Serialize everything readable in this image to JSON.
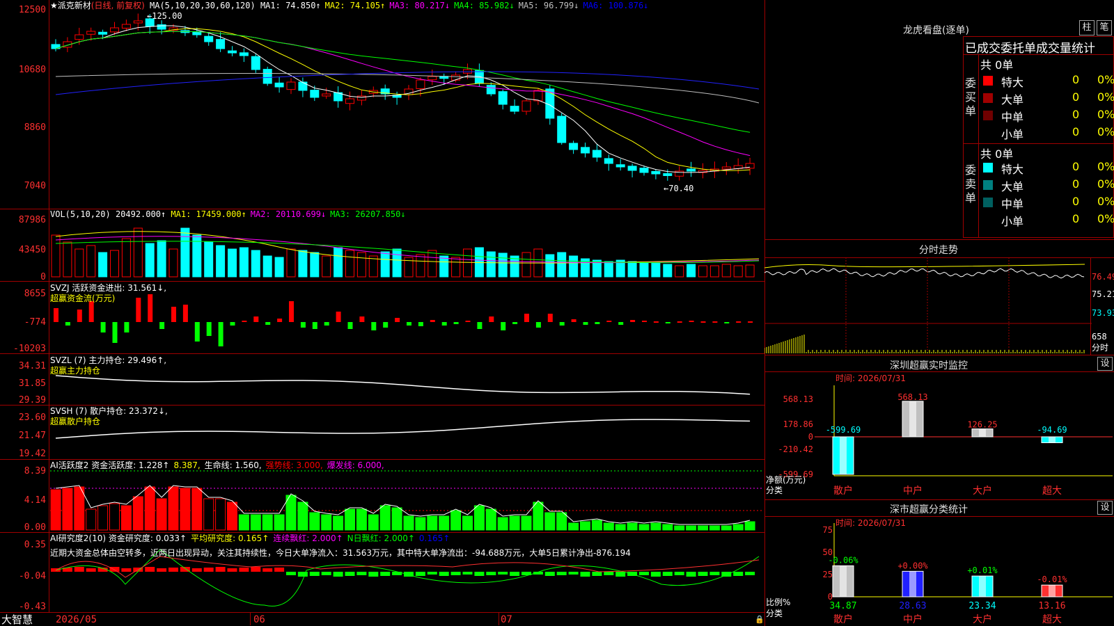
{
  "stock": {
    "name": "★派克新材",
    "mode": "(日线, 前复权)",
    "ma_header": "MA(5,10,20,30,60,120)",
    "ma_values": [
      {
        "label": "MA1: 74.850↑",
        "color": "#ffffff"
      },
      {
        "label": "MA2: 74.105↑",
        "color": "#ffff00"
      },
      {
        "label": "MA3: 80.217↓",
        "color": "#ff00ff"
      },
      {
        "label": "MA4: 85.982↓",
        "color": "#00ff00"
      },
      {
        "label": "MA5: 96.799↓",
        "color": "#c0c0c0"
      },
      {
        "label": "MA6: 100.876↓",
        "color": "#0000ff"
      }
    ]
  },
  "colors": {
    "up": "#ff0000",
    "down": "#00ffff",
    "grid": "#a00000",
    "ma1": "#ffffff",
    "ma2": "#ffff00",
    "ma3": "#ff00ff",
    "ma4": "#00ff00",
    "ma5": "#c0c0c0",
    "ma6": "#2222ff",
    "label_gold": "#ffff00"
  },
  "main_chart": {
    "y_labels": [
      "12500",
      "10680",
      "8860",
      "7040"
    ],
    "high_mark": "←125.00",
    "low_mark": "←70.40"
  },
  "vol_panel": {
    "header_name": "VOL(5,10,20)",
    "header_value": "20492.000↑",
    "ma": [
      {
        "label": "MA1: 17459.000↑",
        "color": "#ffff00"
      },
      {
        "label": "MA2: 20110.699↓",
        "color": "#ff00ff"
      },
      {
        "label": "MA3: 26207.850↓",
        "color": "#00ff00"
      }
    ],
    "y_labels": [
      "87986",
      "43450",
      "0"
    ]
  },
  "svzj_panel": {
    "header": "SVZJ  活跃资金进出: 31.561↓,",
    "sub": "超赢资金流(万元)",
    "y_labels": [
      "8655",
      "-774",
      "-10203"
    ]
  },
  "svzl_panel": {
    "header": "SVZL (7) 主力持仓: 29.496↑,",
    "sub": "超赢主力持仓",
    "y_labels": [
      "34.31",
      "31.85",
      "29.39"
    ]
  },
  "svsh_panel": {
    "header": "SVSH (7) 散户持仓: 23.372↓,",
    "sub": "超赢散户持仓",
    "y_labels": [
      "23.60",
      "21.47",
      "19.42"
    ]
  },
  "ai_active_panel": {
    "header_parts": [
      {
        "text": "AI活跃度2 资金活跃度: 1.228↑",
        "color": "#ffffff"
      },
      {
        "text": "8.387,",
        "color": "#ffff00"
      },
      {
        "text": "生命线: 1.560,",
        "color": "#ffffff"
      },
      {
        "text": "强势线: 3.000,",
        "color": "#ff0000"
      },
      {
        "text": "爆发线: 6.000,",
        "color": "#ff00ff"
      }
    ],
    "y_labels": [
      "8.39",
      "4.14",
      "0.00"
    ]
  },
  "ai_research_panel": {
    "header_parts": [
      {
        "text": "AI研究度2(10) 资金研究度: 0.033↑",
        "color": "#ffffff"
      },
      {
        "text": "平均研究度: 0.165↑",
        "color": "#ffff00"
      },
      {
        "text": "连续飘红: 2.000↑",
        "color": "#ff00ff"
      },
      {
        "text": "N日飘红: 2.000↑",
        "color": "#00ff00"
      },
      {
        "text": "0.165↑",
        "color": "#0000ff"
      }
    ],
    "comment": "近期大资金总体由空转多，近两日出现异动，关注其持续性，今日大单净流入：31.563万元，其中特大单净流出：-94.688万元，大单5日累计净出-876.194",
    "y_labels": [
      "0.35",
      "-0.04",
      "-0.43"
    ]
  },
  "x_axis": {
    "labels": [
      "2026/05",
      "06",
      "07"
    ]
  },
  "bottom": {
    "brand": "大智慧"
  },
  "right_panel": {
    "dragon_title": "龙虎看盘(逐单)",
    "btn_bar": "柱",
    "btn_pen": "笔",
    "order_title": "已成交委托单成交量统计",
    "buy_label": "委买单",
    "sell_label": "委卖单",
    "buy_total": "共 0单",
    "sell_total": "共 0单",
    "buy_rows": [
      {
        "name": "特大",
        "count": "0",
        "pct": "0%",
        "color": "#ff0000"
      },
      {
        "name": "大单",
        "count": "0",
        "pct": "0%",
        "color": "#a00000"
      },
      {
        "name": "中单",
        "count": "0",
        "pct": "0%",
        "color": "#700000"
      },
      {
        "name": "小单",
        "count": "0",
        "pct": "0%",
        "color": ""
      }
    ],
    "sell_rows": [
      {
        "name": "特大",
        "count": "0",
        "pct": "0%",
        "color": "#00ffff"
      },
      {
        "name": "大单",
        "count": "0",
        "pct": "0%",
        "color": "#008080"
      },
      {
        "name": "中单",
        "count": "0",
        "pct": "0%",
        "color": "#006060"
      },
      {
        "name": "小单",
        "count": "0",
        "pct": "0%",
        "color": ""
      }
    ],
    "intraday_title": "分时走势",
    "intraday_prices": [
      "76.49",
      "75.21",
      "73.93"
    ],
    "intraday_vol": "658",
    "intraday_vol_unit": "分时",
    "sz_monitor_title": "深圳超赢实时监控",
    "set_label": "设",
    "sz_time": "时间: 2026/07/31",
    "sz_y": [
      "568.13",
      "178.86",
      "0",
      "-210.42",
      "-599.69"
    ],
    "sz_values": [
      -599.69,
      568.13,
      126.25,
      -94.69
    ],
    "sz_value_labels": [
      "-599.69",
      "568.13",
      "126.25",
      "-94.69"
    ],
    "sz_ylabel": "净额(万元)",
    "cat_label": "分类",
    "categories": [
      "散户",
      "中户",
      "大户",
      "超大"
    ],
    "sc_title": "深市超赢分类统计",
    "sc_time": "时间: 2026/07/31",
    "sc_y": [
      "75",
      "50",
      "25",
      "0"
    ],
    "sc_values": [
      34.87,
      28.63,
      23.34,
      13.16
    ],
    "sc_value_labels": [
      "34.87",
      "28.63",
      "23.34",
      "13.16"
    ],
    "sc_changes": [
      "-0.06%",
      "+0.00%",
      "+0.01%",
      "-0.01%"
    ],
    "sc_ylabel": "比例%"
  }
}
